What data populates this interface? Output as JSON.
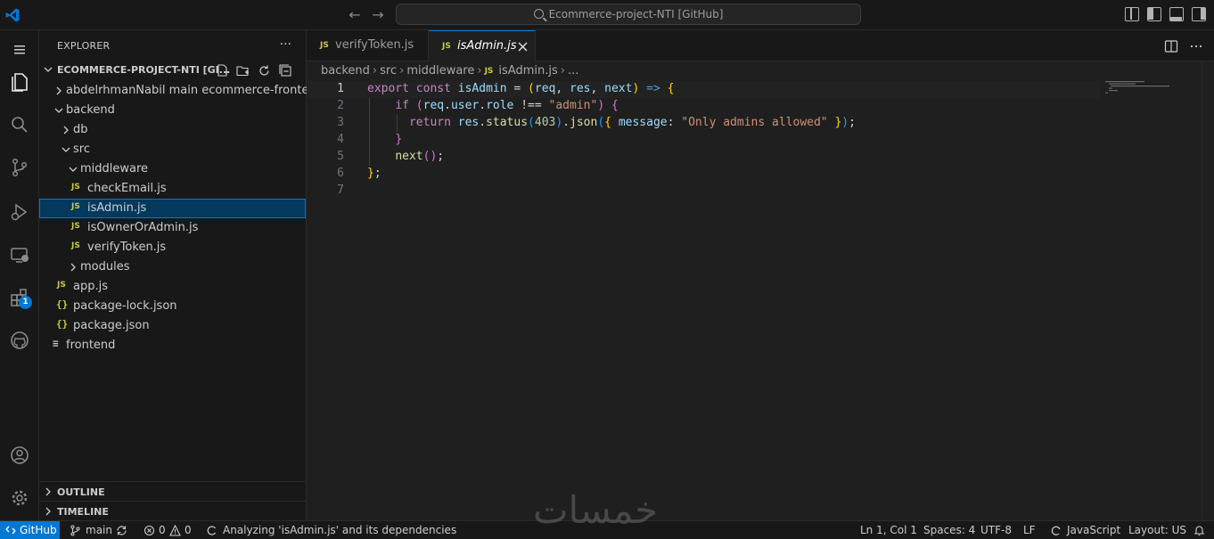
{
  "titlebar": {
    "command_center": "Ecommerce-project-NTI [GitHub]",
    "back_icon": "arrow-left-icon",
    "forward_icon": "arrow-right-icon"
  },
  "activity_bar": {
    "items": [
      "explorer-icon",
      "search-icon",
      "source-control-icon",
      "run-debug-icon",
      "remote-explorer-icon",
      "extensions-icon",
      "github-icon"
    ],
    "extensions_badge": "1",
    "bottom": [
      "accounts-icon",
      "manage-gear-icon"
    ]
  },
  "sidebar": {
    "title": "EXPLORER",
    "more": "···",
    "workspace": "ECOMMERCE-PROJECT-NTI [GI...",
    "tree": [
      {
        "label": "abdelrhmanNabil main ecommerce-frontend",
        "kind": "folder",
        "expanded": false
      },
      {
        "label": "backend",
        "kind": "folder",
        "expanded": true
      },
      {
        "label": "db",
        "kind": "folder",
        "expanded": false
      },
      {
        "label": "src",
        "kind": "folder",
        "expanded": true
      },
      {
        "label": "middleware",
        "kind": "folder",
        "expanded": true
      },
      {
        "label": "checkEmail.js",
        "kind": "js",
        "icon": "JS"
      },
      {
        "label": "isAdmin.js",
        "kind": "js",
        "icon": "JS",
        "selected": true
      },
      {
        "label": "isOwnerOrAdmin.js",
        "kind": "js",
        "icon": "JS"
      },
      {
        "label": "verifyToken.js",
        "kind": "js",
        "icon": "JS"
      },
      {
        "label": "modules",
        "kind": "folder",
        "expanded": false
      },
      {
        "label": "app.js",
        "kind": "js",
        "icon": "JS"
      },
      {
        "label": "package-lock.json",
        "kind": "json",
        "icon": "{}"
      },
      {
        "label": "package.json",
        "kind": "json",
        "icon": "{}"
      },
      {
        "label": "frontend",
        "kind": "submodule"
      }
    ],
    "outline": "OUTLINE",
    "timeline": "TIMELINE"
  },
  "editor": {
    "tabs": [
      {
        "label": "verifyToken.js",
        "icon": "JS",
        "active": false
      },
      {
        "label": "isAdmin.js",
        "icon": "JS",
        "active": true
      }
    ],
    "breadcrumb": [
      "backend",
      "src",
      "middleware",
      "isAdmin.js",
      "..."
    ],
    "breadcrumb_icon": "JS",
    "line_numbers": [
      "1",
      "2",
      "3",
      "4",
      "5",
      "6",
      "7"
    ],
    "current_line": 1,
    "code": [
      "export const isAdmin = (req, res, next) => {",
      "    if (req.user.role !== \"admin\") {",
      "      return res.status(403).json({ message: \"Only admins allowed\" });",
      "    }",
      "    next();",
      "};",
      ""
    ]
  },
  "statusbar": {
    "remote": "GitHub",
    "branch": "main",
    "errors": "0",
    "warnings": "0",
    "analyzing": "Analyzing 'isAdmin.js' and its dependencies",
    "cursor": "Ln 1, Col 1",
    "spaces": "Spaces: 4",
    "encoding": "UTF-8",
    "eol": "LF",
    "language": "JavaScript",
    "layout": "Layout: US"
  },
  "watermark": "خمسات",
  "colors": {
    "accent": "#0078d4",
    "background": "#1f1f1f",
    "sidebar": "#181818",
    "js_icon": "#cbcb41",
    "selection": "#04395e"
  }
}
